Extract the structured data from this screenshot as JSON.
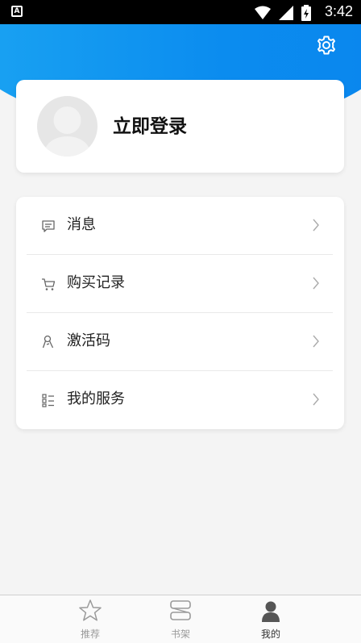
{
  "status_bar": {
    "time": "3:42",
    "left_badge": "A"
  },
  "header": {
    "settings_icon": "gear-icon"
  },
  "login": {
    "label": "立即登录",
    "avatar_icon": "avatar-placeholder-icon"
  },
  "menu": {
    "items": [
      {
        "label": "消息",
        "icon": "message-icon"
      },
      {
        "label": "购买记录",
        "icon": "cart-icon"
      },
      {
        "label": "激活码",
        "icon": "key-icon"
      },
      {
        "label": "我的服务",
        "icon": "service-list-icon"
      }
    ]
  },
  "tabbar": {
    "tabs": [
      {
        "label": "推荐",
        "icon": "star-icon"
      },
      {
        "label": "书架",
        "icon": "bookshelf-icon"
      },
      {
        "label": "我的",
        "icon": "user-icon"
      }
    ],
    "active": "我的"
  },
  "colors": {
    "accent": "#0b8cef",
    "page_bg": "#f4f4f4"
  }
}
